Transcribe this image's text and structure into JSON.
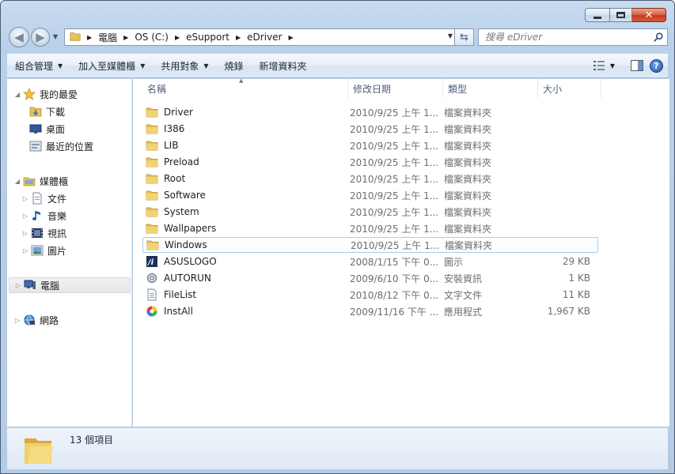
{
  "address": {
    "crumbs": [
      "電腦",
      "OS (C:)",
      "eSupport",
      "eDriver"
    ]
  },
  "search": {
    "placeholder": "搜尋 eDriver"
  },
  "toolbar": {
    "organize": "組合管理",
    "include_library": "加入至媒體櫃",
    "share": "共用對象",
    "burn": "燒錄",
    "new_folder": "新增資料夾"
  },
  "help_label": "?",
  "nav": {
    "favorites": "我的最愛",
    "downloads": "下載",
    "desktop": "桌面",
    "recent": "最近的位置",
    "libraries": "媒體櫃",
    "documents": "文件",
    "music": "音樂",
    "videos": "視訊",
    "pictures": "圖片",
    "computer": "電腦",
    "network": "網路"
  },
  "columns": {
    "name": "名稱",
    "date": "修改日期",
    "type": "類型",
    "size": "大小"
  },
  "files": [
    {
      "name": "Driver",
      "date": "2010/9/25 上午 1...",
      "type": "檔案資料夾",
      "size": "",
      "icon": "folder-icon"
    },
    {
      "name": "I386",
      "date": "2010/9/25 上午 1...",
      "type": "檔案資料夾",
      "size": "",
      "icon": "folder-icon"
    },
    {
      "name": "LIB",
      "date": "2010/9/25 上午 1...",
      "type": "檔案資料夾",
      "size": "",
      "icon": "folder-icon"
    },
    {
      "name": "Preload",
      "date": "2010/9/25 上午 1...",
      "type": "檔案資料夾",
      "size": "",
      "icon": "folder-icon"
    },
    {
      "name": "Root",
      "date": "2010/9/25 上午 1...",
      "type": "檔案資料夾",
      "size": "",
      "icon": "folder-icon"
    },
    {
      "name": "Software",
      "date": "2010/9/25 上午 1...",
      "type": "檔案資料夾",
      "size": "",
      "icon": "folder-icon"
    },
    {
      "name": "System",
      "date": "2010/9/25 上午 1...",
      "type": "檔案資料夾",
      "size": "",
      "icon": "folder-icon"
    },
    {
      "name": "Wallpapers",
      "date": "2010/9/25 上午 1...",
      "type": "檔案資料夾",
      "size": "",
      "icon": "folder-icon"
    },
    {
      "name": "Windows",
      "date": "2010/9/25 上午 1...",
      "type": "檔案資料夾",
      "size": "",
      "icon": "folder-icon"
    },
    {
      "name": "ASUSLOGO",
      "date": "2008/1/15 下午 0...",
      "type": "圖示",
      "size": "29 KB",
      "icon": "asus-logo-icon"
    },
    {
      "name": "AUTORUN",
      "date": "2009/6/10 下午 0...",
      "type": "安裝資訊",
      "size": "1 KB",
      "icon": "setup-info-icon"
    },
    {
      "name": "FileList",
      "date": "2010/8/12 下午 0...",
      "type": "文字文件",
      "size": "11 KB",
      "icon": "text-document-icon"
    },
    {
      "name": "InstAll",
      "date": "2009/11/16 下午 ...",
      "type": "應用程式",
      "size": "1,967 KB",
      "icon": "application-icon"
    }
  ],
  "status": {
    "item_count": "13 個項目"
  },
  "colors": {
    "accent": "#3567a7",
    "hover_border": "#a8cdee",
    "folder": "#e8c25a"
  }
}
